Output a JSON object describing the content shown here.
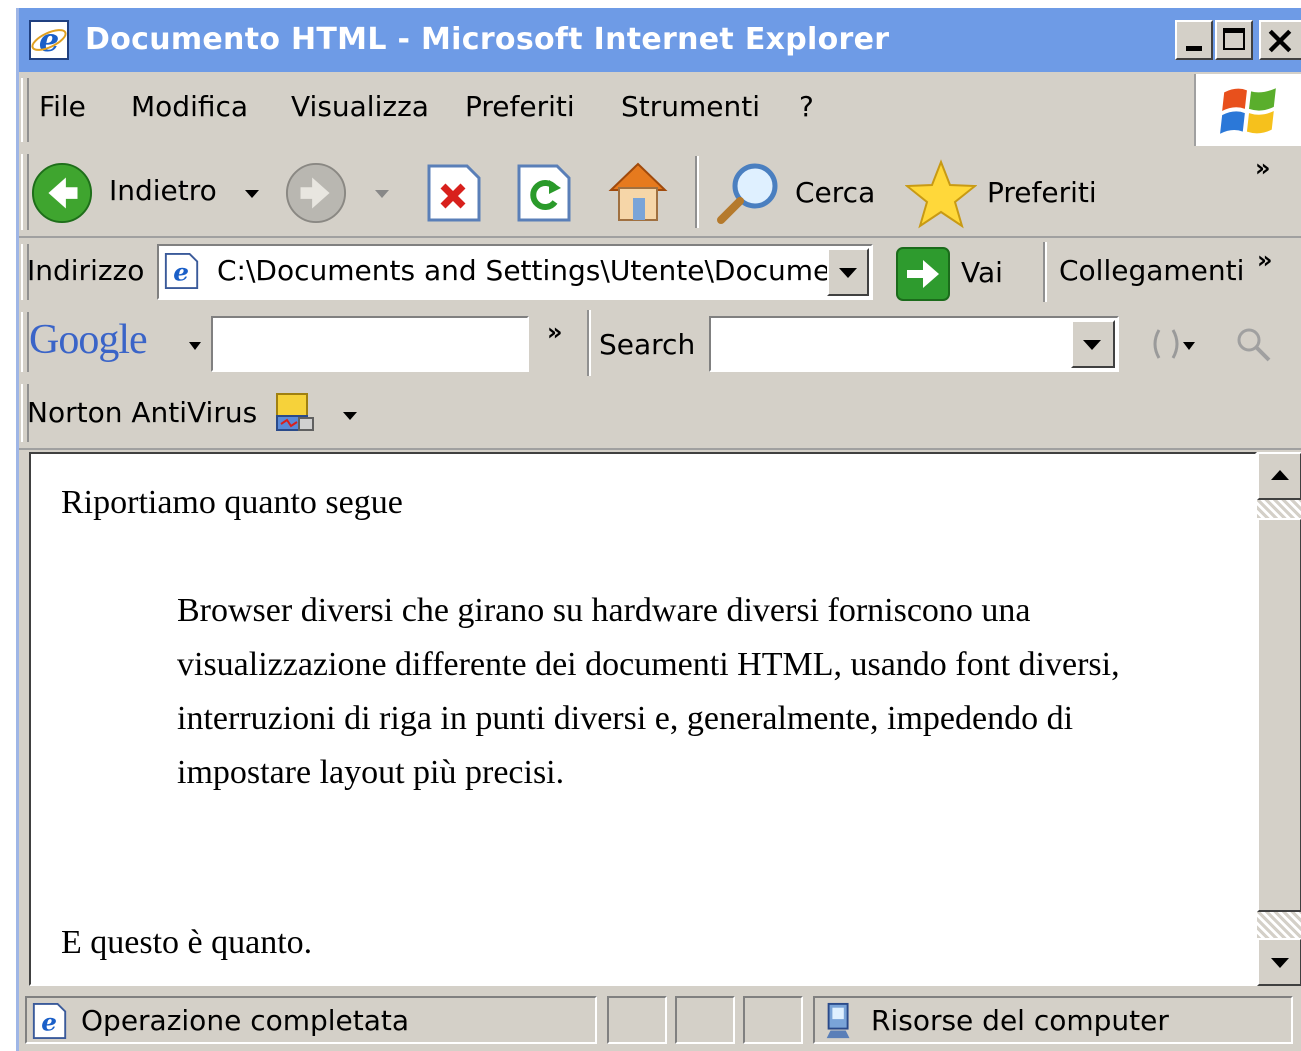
{
  "window": {
    "title": "Documento HTML - Microsoft Internet Explorer"
  },
  "menu": {
    "items": [
      "File",
      "Modifica",
      "Visualizza",
      "Preferiti",
      "Strumenti",
      "?"
    ]
  },
  "toolbar": {
    "back_label": "Indietro",
    "search_label": "Cerca",
    "favorites_label": "Preferiti",
    "chevron": "»"
  },
  "address": {
    "label": "Indirizzo",
    "value": "C:\\Documents and Settings\\Utente\\Docume",
    "go_label": "Vai",
    "links_label": "Collegamenti",
    "chevron": "»"
  },
  "google_bar": {
    "brand": "Google",
    "search_label": "Search",
    "chevron": "»"
  },
  "norton_bar": {
    "label": "Norton AntiVirus"
  },
  "content": {
    "intro": "Riportiamo quanto segue",
    "quote": "Browser diversi che girano su hardware diversi forniscono una visualizzazione differente dei documenti HTML, usando font diversi, interruzioni di riga in punti diversi e, generalmente, impedendo di impostare layout più precisi.",
    "outro": "E questo è quanto."
  },
  "status": {
    "text": "Operazione completata",
    "zone": "Risorse del computer"
  },
  "colors": {
    "titlebar": "#6e9be6",
    "chrome": "#d4d0c8",
    "go_green": "#2e9b2e"
  }
}
